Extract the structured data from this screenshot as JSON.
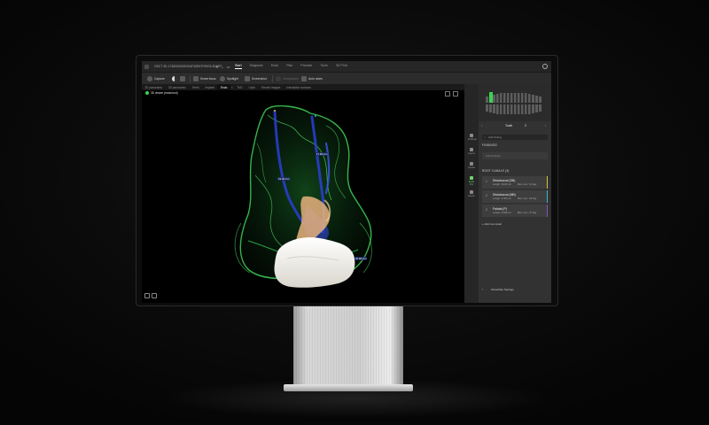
{
  "app": {
    "file_title": "CBCT 3D-1748300020020AF45B37F50D3.3DAPP",
    "menu_tabs": [
      "Start",
      "Diagnose",
      "Endo",
      "Plan",
      "Practice",
      "Tools",
      "3D Print"
    ],
    "active_menu": "Start"
  },
  "toolbar": {
    "capture": "Capture",
    "smart_focus": "Smart focus",
    "spotlight": "Spotlight",
    "screenshot": "Screenshot",
    "comparison": "Comparison",
    "auto_notes": "Auto notes"
  },
  "view_tabs": [
    "3D panorama",
    "3D panoramic",
    "Teeth",
    "Implant",
    "Endo",
    "TMJ",
    "Ceph",
    "Recent images",
    "Interactive surfaces"
  ],
  "active_view_tab": "Endo",
  "view_label": "3D viewer (endo/root)",
  "side_icons": [
    "Findings",
    "Layers",
    "Canals",
    "Endo Pro",
    "Export"
  ],
  "active_side_icon": "Endo Pro",
  "tooth_nav": {
    "label": "Tooth",
    "number": "2"
  },
  "search": {
    "placeholder": "Add finding"
  },
  "findings": {
    "title": "FINDINGS",
    "placeholder": "Add findings"
  },
  "root_canals": {
    "title": "ROOT CANALS (3)",
    "items": [
      {
        "index": "1",
        "name": "Distobuccal (DB)",
        "length": "Length: 19.34 mm",
        "max_curv": "Max. curv.: 41 deg",
        "color": "#d4c43b"
      },
      {
        "index": "2",
        "name": "Distobuccal (MB)",
        "length": "Length: 17.82 mm",
        "max_curv": "Max. curv.: 29 deg",
        "color": "#3ab6c8"
      },
      {
        "index": "3",
        "name": "Palatal (P)",
        "length": "Length: 20.98 mm",
        "max_curv": "Max. curv.: 37 deg",
        "color": "#7e5ab8"
      }
    ],
    "add_label": "Add root canal"
  },
  "show_settings": "Show/hide Settings",
  "overlay_labels": [
    "19.34 mm",
    "17.82 mm",
    "20.98 mm"
  ],
  "colors": {
    "accent": "#39d353",
    "bone": "#3fd05a",
    "canal": "#2a3fd6",
    "crown": "#f2f0ea"
  }
}
